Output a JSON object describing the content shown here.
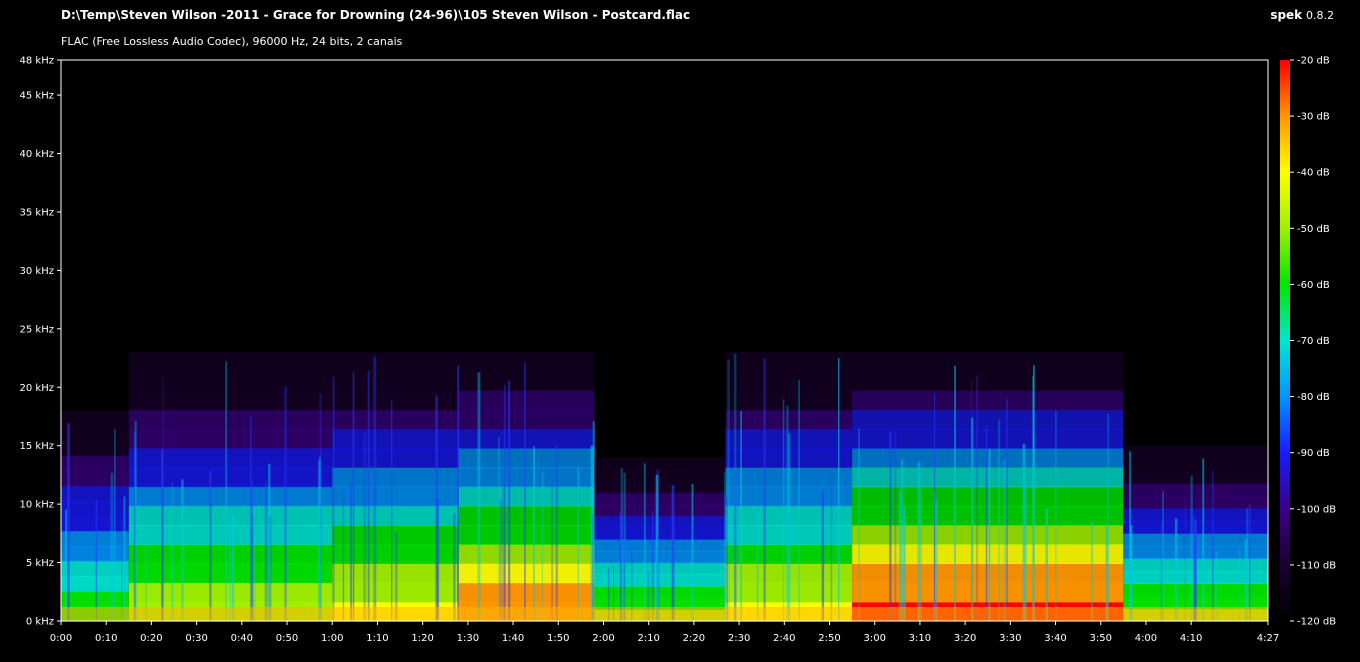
{
  "header": {
    "file_path": "D:\\Temp\\Steven Wilson -2011 - Grace for Drowning (24-96)\\105 Steven Wilson - Postcard.flac",
    "codec_info": "FLAC (Free Lossless Audio Codec), 96000 Hz, 24 bits, 2 canais",
    "app_name": "spek",
    "app_version": "0.8.2"
  },
  "chart_data": {
    "type": "heatmap",
    "title": "",
    "xlabel": "",
    "ylabel": "",
    "x_ticks": [
      {
        "label": "0:00",
        "sec": 0
      },
      {
        "label": "0:10",
        "sec": 10
      },
      {
        "label": "0:20",
        "sec": 20
      },
      {
        "label": "0:30",
        "sec": 30
      },
      {
        "label": "0:40",
        "sec": 40
      },
      {
        "label": "0:50",
        "sec": 50
      },
      {
        "label": "1:00",
        "sec": 60
      },
      {
        "label": "1:10",
        "sec": 70
      },
      {
        "label": "1:20",
        "sec": 80
      },
      {
        "label": "1:30",
        "sec": 90
      },
      {
        "label": "1:40",
        "sec": 100
      },
      {
        "label": "1:50",
        "sec": 110
      },
      {
        "label": "2:00",
        "sec": 120
      },
      {
        "label": "2:10",
        "sec": 130
      },
      {
        "label": "2:20",
        "sec": 140
      },
      {
        "label": "2:30",
        "sec": 150
      },
      {
        "label": "2:40",
        "sec": 160
      },
      {
        "label": "2:50",
        "sec": 170
      },
      {
        "label": "3:00",
        "sec": 180
      },
      {
        "label": "3:10",
        "sec": 190
      },
      {
        "label": "3:20",
        "sec": 200
      },
      {
        "label": "3:30",
        "sec": 210
      },
      {
        "label": "3:40",
        "sec": 220
      },
      {
        "label": "3:50",
        "sec": 230
      },
      {
        "label": "4:00",
        "sec": 240
      },
      {
        "label": "4:10",
        "sec": 250
      },
      {
        "label": "4:27",
        "sec": 267
      }
    ],
    "duration_sec": 267,
    "y_ticks": [
      {
        "label": "0 kHz",
        "khz": 0
      },
      {
        "label": "5 kHz",
        "khz": 5
      },
      {
        "label": "10 kHz",
        "khz": 10
      },
      {
        "label": "15 kHz",
        "khz": 15
      },
      {
        "label": "20 kHz",
        "khz": 20
      },
      {
        "label": "25 kHz",
        "khz": 25
      },
      {
        "label": "30 kHz",
        "khz": 30
      },
      {
        "label": "35 kHz",
        "khz": 35
      },
      {
        "label": "40 kHz",
        "khz": 40
      },
      {
        "label": "45 kHz",
        "khz": 45
      },
      {
        "label": "48 kHz",
        "khz": 48
      }
    ],
    "ylim_khz": [
      0,
      48
    ],
    "colorbar": {
      "ticks": [
        "-20 dB",
        "-30 dB",
        "-40 dB",
        "-50 dB",
        "-60 dB",
        "-70 dB",
        "-80 dB",
        "-90 dB",
        "-100 dB",
        "-110 dB",
        "-120 dB"
      ],
      "range_db": [
        -120,
        -20
      ],
      "colors": [
        "#000000",
        "#1a0030",
        "#3c008a",
        "#1a1aff",
        "#0096ff",
        "#00e6d2",
        "#00e600",
        "#a0f000",
        "#ffff00",
        "#ff9600",
        "#ff0000"
      ]
    },
    "segments": [
      {
        "start": 0,
        "end": 15,
        "max_khz": 18,
        "level": 0.42
      },
      {
        "start": 15,
        "end": 60,
        "max_khz": 23,
        "level": 0.52
      },
      {
        "start": 60,
        "end": 88,
        "max_khz": 23,
        "level": 0.6
      },
      {
        "start": 88,
        "end": 118,
        "max_khz": 23,
        "level": 0.72
      },
      {
        "start": 118,
        "end": 147,
        "max_khz": 14,
        "level": 0.5
      },
      {
        "start": 147,
        "end": 175,
        "max_khz": 23,
        "level": 0.58
      },
      {
        "start": 175,
        "end": 235,
        "max_khz": 23,
        "level": 0.8
      },
      {
        "start": 235,
        "end": 267,
        "max_khz": 15,
        "level": 0.45
      }
    ]
  }
}
